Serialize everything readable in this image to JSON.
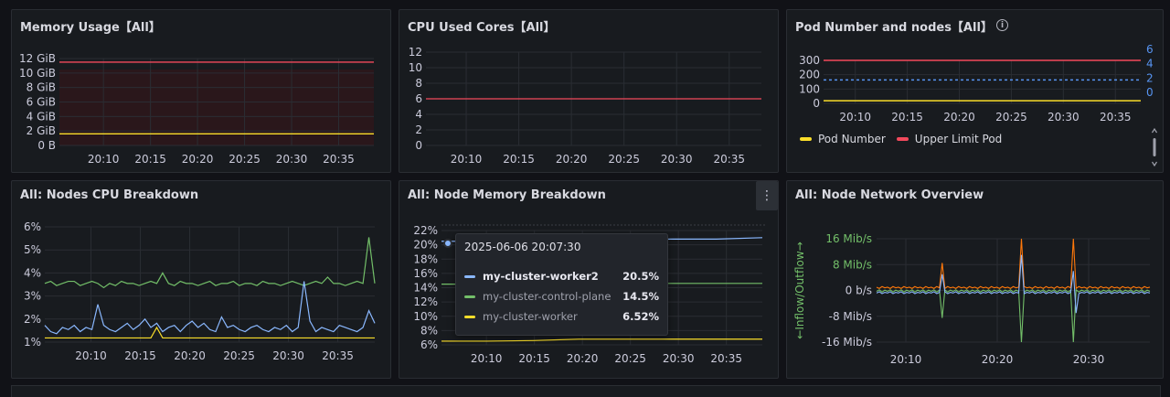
{
  "panels": {
    "memory": {
      "title": "Memory Usage【All】",
      "chart_data": {
        "type": "line",
        "x": [
          "20:10",
          "20:15",
          "20:20",
          "20:25",
          "20:30",
          "20:35"
        ],
        "yticks": [
          "12 GiB",
          "10 GiB",
          "8 GiB",
          "6 GiB",
          "4 GiB",
          "2 GiB",
          "0 B"
        ],
        "ylim": [
          0,
          12
        ],
        "series": [
          {
            "color": "#f2495c",
            "values": [
              11.5,
              11.5,
              11.5,
              11.5,
              11.5,
              11.5
            ]
          },
          {
            "color": "#fade2a",
            "values": [
              1.6,
              1.6,
              1.6,
              1.6,
              1.6,
              1.6
            ]
          }
        ]
      }
    },
    "cpu": {
      "title": "CPU Used Cores【All】",
      "chart_data": {
        "type": "line",
        "x": [
          "20:10",
          "20:15",
          "20:20",
          "20:25",
          "20:30",
          "20:35"
        ],
        "yticks": [
          "12",
          "10",
          "8",
          "6",
          "4",
          "2",
          "0"
        ],
        "ylim": [
          0,
          12
        ],
        "series": [
          {
            "color": "#f2495c",
            "values": [
              6,
              6,
              6,
              6,
              6,
              6
            ]
          }
        ]
      }
    },
    "pods": {
      "title": "Pod Number and nodes【All】",
      "info_icon": "i",
      "chart_data": {
        "type": "line",
        "x": [
          "20:10",
          "20:15",
          "20:20",
          "20:25",
          "20:30",
          "20:35"
        ],
        "yticks_left": [
          "300",
          "200",
          "100",
          "0"
        ],
        "yticks_right": [
          "6",
          "4",
          "2",
          "0"
        ],
        "ylim": [
          0,
          330
        ],
        "series": [
          {
            "name": "Pod Number",
            "color": "#fade2a",
            "values": [
              20,
              20,
              20,
              20,
              20,
              20
            ]
          },
          {
            "name": "Upper Limit Pod",
            "color": "#f2495c",
            "values": [
              330,
              330,
              330,
              330,
              330,
              330
            ]
          },
          {
            "color": "#5794f2",
            "values": [
              180,
              180,
              180,
              180,
              180,
              180
            ]
          }
        ]
      },
      "legend": [
        {
          "label": "Pod Number",
          "color": "#fade2a"
        },
        {
          "label": "Upper Limit Pod",
          "color": "#f2495c"
        }
      ]
    },
    "nodes_cpu": {
      "title": "All:  Nodes CPU Breakdown",
      "chart_data": {
        "type": "line",
        "x": [
          "20:10",
          "20:15",
          "20:20",
          "20:25",
          "20:30",
          "20:35"
        ],
        "yticks": [
          "6%",
          "5%",
          "4%",
          "3%",
          "2%",
          "1%"
        ],
        "ylim": [
          0.5,
          6
        ],
        "series": [
          {
            "color": "#73bf69",
            "values": [
              3.3,
              3.4,
              3.2,
              3.3,
              3.4,
              3.4,
              3.2,
              3.3,
              3.4,
              3.3,
              3.1,
              3.3,
              3.2,
              3.4,
              3.3,
              3.3,
              3.2,
              3.3,
              3.4,
              3.3,
              3.8,
              3.3,
              3.2,
              3.4,
              3.3,
              3.3,
              3.2,
              3.3,
              3.4,
              3.2,
              3.3,
              3.3,
              3.4,
              3.2,
              3.3,
              3.3,
              3.2,
              3.4,
              3.3,
              3.3,
              3.2,
              3.3,
              3.4,
              3.3,
              3.2,
              3.3,
              3.4,
              3.3,
              3.6,
              3.3,
              3.3,
              3.2,
              3.3,
              3.4,
              3.3,
              5.5,
              3.3
            ]
          },
          {
            "color": "#8ab8ff",
            "values": [
              1.3,
              1.0,
              0.9,
              1.2,
              1.1,
              1.3,
              1.0,
              1.2,
              1.1,
              2.3,
              1.3,
              1.1,
              1.0,
              1.2,
              1.4,
              1.1,
              1.3,
              1.6,
              1.2,
              1.4,
              1.0,
              1.2,
              1.3,
              1.0,
              1.3,
              1.5,
              1.2,
              1.4,
              1.1,
              1.0,
              1.7,
              1.2,
              1.3,
              1.1,
              1.0,
              1.2,
              1.3,
              1.1,
              1.0,
              1.2,
              1.1,
              1.3,
              1.0,
              1.2,
              3.4,
              1.5,
              1.0,
              1.2,
              1.1,
              1.0,
              1.3,
              1.2,
              1.1,
              1.0,
              1.2,
              2.0,
              1.4
            ]
          },
          {
            "color": "#fade2a",
            "values": [
              0.7,
              0.7,
              0.7,
              0.7,
              0.7,
              0.7,
              0.7,
              0.7,
              0.7,
              0.7,
              0.7,
              0.7,
              0.7,
              0.7,
              0.7,
              0.7,
              0.7,
              0.7,
              0.7,
              1.2,
              0.7,
              0.7,
              0.7,
              0.7,
              0.7,
              0.7,
              0.7,
              0.7,
              0.7,
              0.7,
              0.7,
              0.7,
              0.7,
              0.7,
              0.7,
              0.7,
              0.7,
              0.7,
              0.7,
              0.7,
              0.7,
              0.7,
              0.7,
              0.7,
              0.7,
              0.7,
              0.7,
              0.7,
              0.7,
              0.7,
              0.7,
              0.7,
              0.7,
              0.7,
              0.7,
              0.7,
              0.7
            ]
          }
        ]
      }
    },
    "node_memory": {
      "title": "All:  Node Memory Breakdown",
      "menu_icon": "⋮",
      "chart_data": {
        "type": "line",
        "x": [
          "20:10",
          "20:15",
          "20:20",
          "20:25",
          "20:30",
          "20:35"
        ],
        "yticks": [
          "22%",
          "20%",
          "18%",
          "16%",
          "14%",
          "12%",
          "10%",
          "8%",
          "6%"
        ],
        "ylim": [
          6,
          22
        ],
        "series": [
          {
            "name": "my-cluster-worker2",
            "color": "#8ab8ff",
            "values": [
              20.5,
              20.5,
              20.5,
              20.6,
              20.7,
              20.8,
              20.8,
              21.0
            ]
          },
          {
            "name": "my-cluster-control-plane",
            "color": "#73bf69",
            "values": [
              14.5,
              14.5,
              14.6,
              14.7,
              14.6,
              14.6,
              14.6,
              14.6
            ]
          },
          {
            "name": "my-cluster-worker",
            "color": "#fade2a",
            "values": [
              6.52,
              6.52,
              6.6,
              6.8,
              6.8,
              6.8,
              6.8,
              6.8
            ]
          }
        ]
      },
      "tooltip": {
        "time": "2025-06-06 20:07:30",
        "rows": [
          {
            "name": "my-cluster-worker2",
            "value": "20.5%",
            "color": "#8ab8ff"
          },
          {
            "name": "my-cluster-control-plane",
            "value": "14.5%",
            "color": "#73bf69"
          },
          {
            "name": "my-cluster-worker",
            "value": "6.52%",
            "color": "#fade2a"
          }
        ]
      }
    },
    "network": {
      "title": "All:  Node Network Overview",
      "chart_data": {
        "type": "line",
        "x": [
          "20:10",
          "20:20",
          "20:30"
        ],
        "yticks": [
          "16 Mib/s",
          "8 Mib/s",
          "0 b/s",
          "-8 Mib/s",
          "-16 Mib/s"
        ],
        "ylabel": "←Inflow/Outflow→",
        "ylim": [
          -16,
          16
        ],
        "series": [
          {
            "color": "#ff780a",
            "values": [
              0.5,
              1,
              0.5,
              1,
              0.5,
              1,
              0.5,
              1,
              0.5,
              1,
              0.5,
              1,
              0.8,
              0.5,
              1,
              0.5,
              1,
              0.5,
              1,
              0.5,
              1,
              0.5,
              1,
              0.5,
              1,
              0.5,
              1,
              0.5,
              1,
              0.5,
              1,
              0.5,
              1,
              0.5,
              1,
              0.5,
              1,
              0.5,
              1,
              0.5,
              1,
              0.5,
              1,
              0.5,
              1,
              0.5,
              1,
              0.5,
              1,
              0.5,
              1,
              0.5,
              1,
              0.5,
              1,
              0.5,
              1,
              0.5,
              1,
              0.5,
              1,
              0.5,
              1,
              0.5,
              1,
              0.5,
              1,
              0.5,
              1,
              0.5,
              1,
              0.5,
              1,
              0.5,
              1,
              0.5,
              1,
              0.5,
              1,
              0.5,
              1,
              0.5,
              1,
              0.5,
              1,
              0.5,
              1,
              0.5,
              1,
              0.5,
              1,
              0.5,
              1,
              0.5,
              1,
              0.5,
              1,
              0.5,
              1,
              0.5,
              1
            ]
          },
          {
            "color": "#73bf69",
            "values": [
              0,
              0,
              0,
              0,
              0,
              0,
              0,
              0,
              0,
              0,
              0,
              0,
              0,
              0,
              0,
              0,
              0,
              0,
              0,
              0,
              0,
              0,
              0,
              0,
              0,
              0,
              0,
              0,
              0,
              0,
              0,
              0,
              0,
              0,
              0,
              0,
              0,
              0,
              0,
              0,
              0,
              0,
              0,
              0,
              0,
              0,
              0,
              0,
              0,
              0,
              0,
              0,
              0,
              0,
              0,
              0,
              0,
              0,
              0,
              0,
              0,
              0,
              0,
              0,
              0,
              0,
              0,
              0,
              0,
              0,
              0,
              0,
              0,
              0,
              0,
              0,
              0,
              0,
              0,
              0,
              0,
              0,
              0,
              0,
              0,
              0,
              0,
              0,
              0,
              0,
              0,
              0,
              0,
              0,
              0,
              0,
              0,
              0,
              0,
              0,
              0,
              0,
              0
            ]
          },
          {
            "color": "#8ab8ff",
            "values": [
              0,
              0,
              0,
              0,
              0,
              0,
              0,
              0,
              0,
              0,
              0,
              0,
              0,
              0,
              0,
              0,
              0,
              0,
              0,
              0,
              0,
              0,
              0,
              0,
              0,
              0,
              0,
              0,
              0,
              0,
              0,
              0,
              0,
              0,
              0,
              0,
              0,
              0,
              0,
              0,
              0,
              0,
              0,
              0,
              0,
              0,
              0,
              0,
              0,
              0,
              0,
              0,
              0,
              0,
              0,
              0,
              0,
              0,
              0,
              0,
              0,
              0,
              0,
              0,
              0,
              0,
              0,
              0,
              0,
              0,
              0,
              0,
              0,
              0,
              0,
              0,
              0,
              0,
              0,
              0,
              0,
              0,
              0,
              0,
              0,
              0,
              0,
              0,
              0,
              0,
              0,
              0,
              0,
              0,
              0,
              0,
              0,
              0,
              0,
              0,
              0,
              0,
              0
            ]
          }
        ]
      }
    }
  }
}
